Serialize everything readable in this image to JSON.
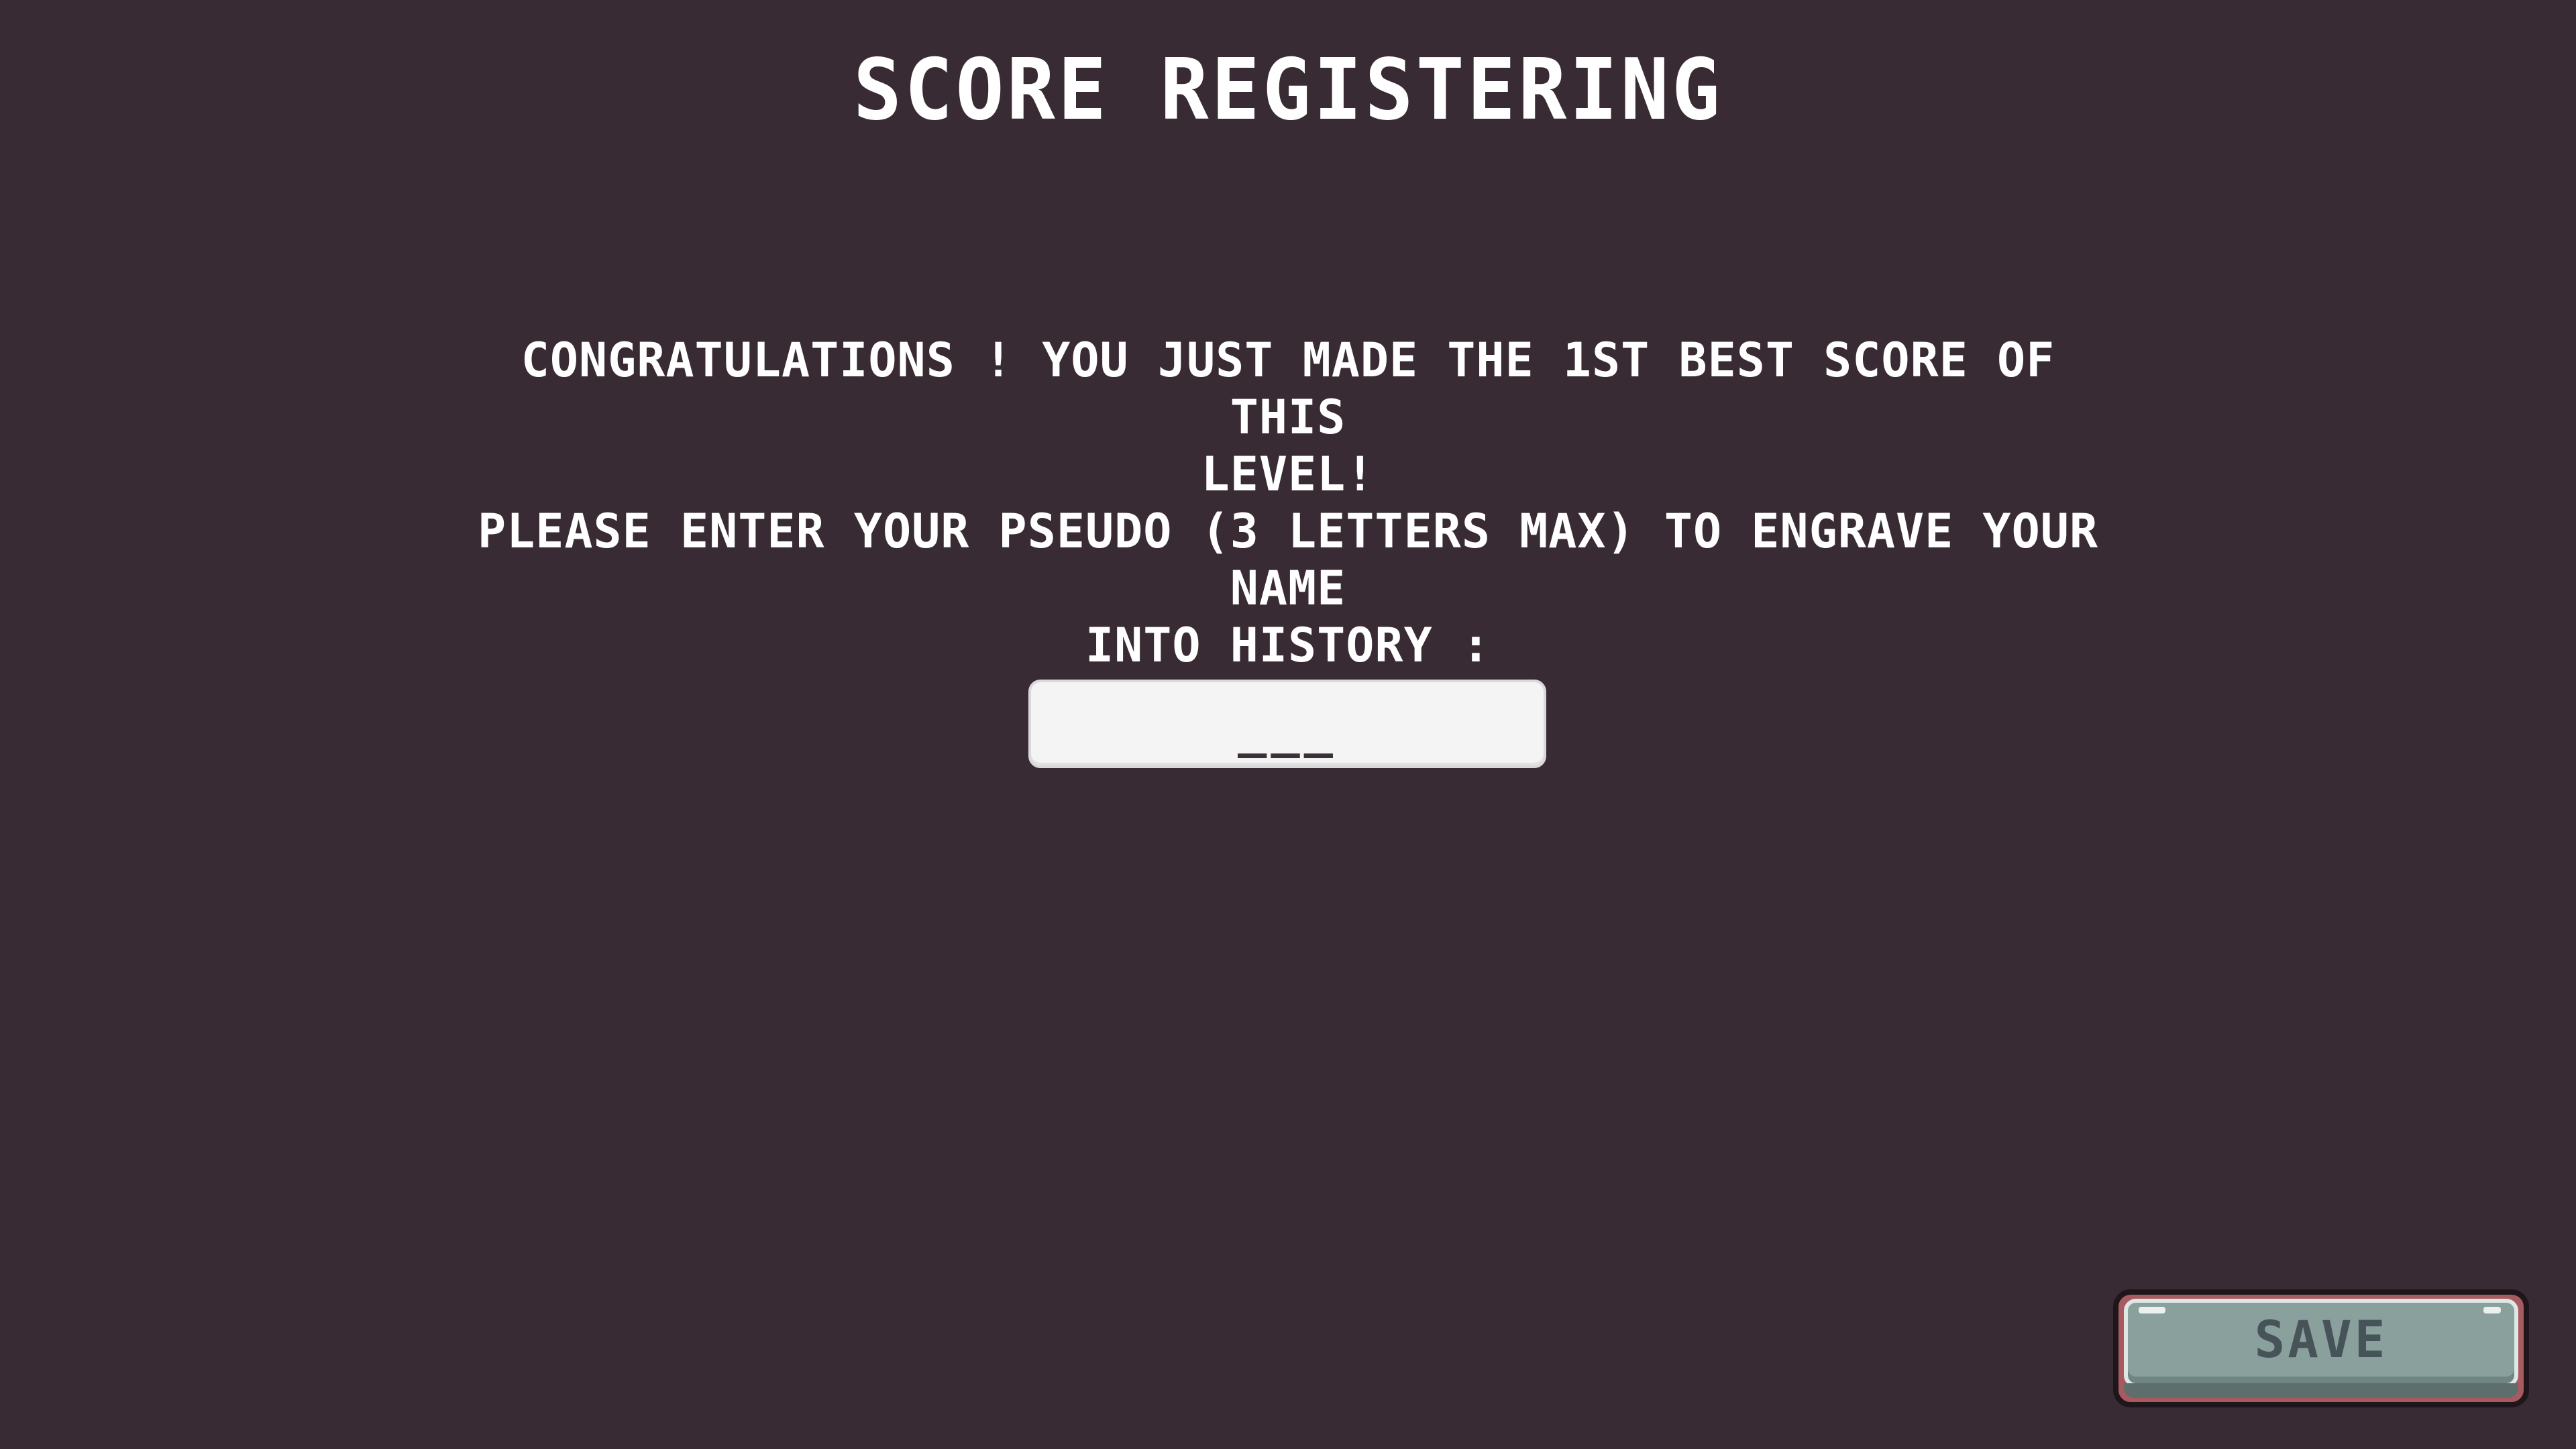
{
  "screen": {
    "title": "SCORE REGISTERING",
    "message_lines": [
      "CONGRATULATIONS ! YOU JUST MADE THE 1ST BEST SCORE OF THIS",
      "LEVEL!",
      "PLEASE ENTER YOUR PSEUDO (3 LETTERS MAX) TO ENGRAVE YOUR NAME",
      "INTO HISTORY :"
    ]
  },
  "pseudo_input": {
    "value": "",
    "placeholder": "___",
    "max_letters": 3
  },
  "save_button": {
    "label": "SAVE"
  },
  "colors": {
    "background": "#392b33",
    "text": "#ffffff",
    "input_background": "#f4f4f4",
    "button_face": "#8aa09c",
    "button_label": "#46545a",
    "button_border": "#a75a5f"
  }
}
